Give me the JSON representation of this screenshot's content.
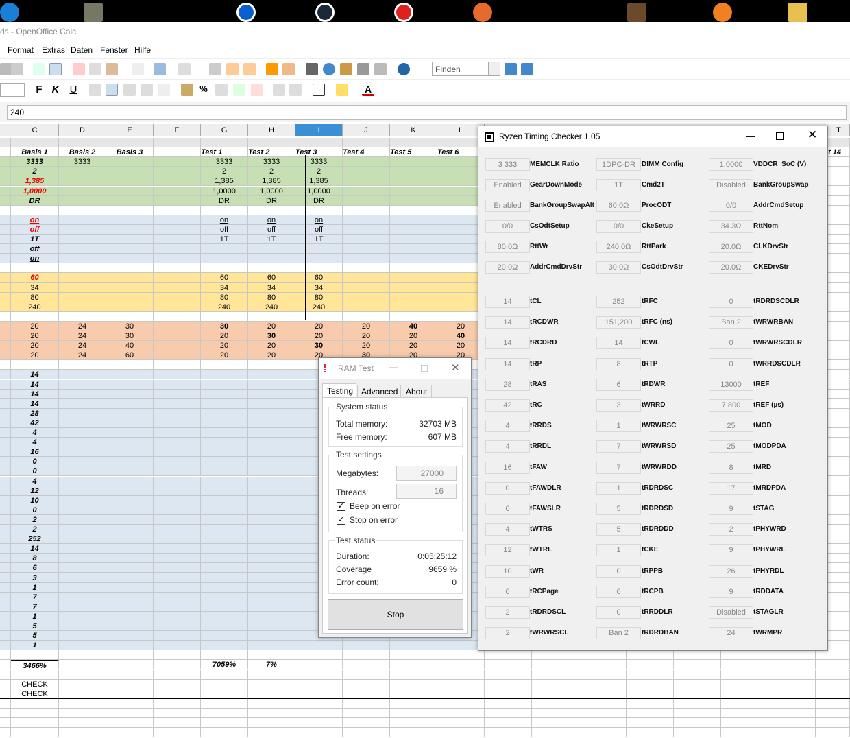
{
  "app": {
    "title": "ds - OpenOffice Calc",
    "menu": [
      "Format",
      "Extras",
      "Daten",
      "Fenster",
      "Hilfe"
    ],
    "find_placeholder": "Finden",
    "formula_value": "240",
    "columns": [
      "C",
      "D",
      "E",
      "F",
      "G",
      "H",
      "I",
      "J",
      "K",
      "L",
      "T"
    ]
  },
  "sheet": {
    "headers": [
      "Basis 1",
      "Basis 2",
      "Basis 3",
      "",
      "Test 1",
      "Test 2",
      "Test 3",
      "Test 4",
      "Test 5",
      "Test 6",
      "st 14"
    ],
    "col_c_top": [
      "3333",
      "2",
      "1,385",
      "1,0000",
      "DR"
    ],
    "col_d_top": "3333",
    "col_g_top": [
      "3333",
      "2",
      "1,385",
      "1,0000",
      "DR"
    ],
    "col_h_top": [
      "3333",
      "2",
      "1,385",
      "1,0000",
      "DR"
    ],
    "col_i_top": [
      "3333",
      "2",
      "1,385"
    ],
    "col_i_mid": [
      "1,0000",
      "DR"
    ],
    "toggles_c": [
      "on",
      "off",
      "1T",
      "off",
      "on"
    ],
    "toggles_g": [
      "on",
      "off",
      "1T"
    ],
    "toggles_h": [
      "on",
      "off",
      "1T"
    ],
    "toggles_i": [
      "on",
      "off",
      "1T"
    ],
    "yellow_c": [
      "60",
      "34",
      "80",
      "240"
    ],
    "yellow_g": [
      "60",
      "34",
      "80",
      "240"
    ],
    "yellow_h": [
      "60",
      "34",
      "80",
      "240"
    ],
    "yellow_i": [
      "60",
      "34",
      "80",
      "240"
    ],
    "orange_c": [
      "20",
      "20",
      "20",
      "20"
    ],
    "orange_d": [
      "24",
      "24",
      "24",
      "24"
    ],
    "orange_e": [
      "30",
      "30",
      "40",
      "60"
    ],
    "orange_g": [
      "30",
      "20",
      "20",
      "20"
    ],
    "orange_h": [
      "20",
      "30",
      "20",
      "20"
    ],
    "orange_i": [
      "20",
      "20",
      "30",
      "20"
    ],
    "orange_j": [
      "20",
      "20",
      "20",
      "30"
    ],
    "orange_k": [
      "40",
      "20",
      "20",
      "20"
    ],
    "orange_l": [
      "20",
      "40",
      "20",
      "20"
    ],
    "blue_c": [
      "14",
      "14",
      "14",
      "14",
      "28",
      "42",
      "4",
      "4",
      "16",
      "0",
      "0",
      "4",
      "12",
      "10",
      "0",
      "2",
      "2",
      "252",
      "14",
      "8",
      "6",
      "3",
      "1",
      "7",
      "7",
      "1",
      "5",
      "5",
      "1"
    ],
    "pct_c": "3466%",
    "pct_g": "7059%",
    "pct_h": "7%",
    "check1": "CHECK",
    "check2": "CHECK"
  },
  "rtc": {
    "title": "Ryzen Timing Checker 1.05",
    "top": [
      [
        "3 333",
        "MEMCLK Ratio",
        "1DPC-DR",
        "DIMM Config",
        "1,0000",
        "VDDCR_SoC (V)"
      ],
      [
        "Enabled",
        "GearDownMode",
        "1T",
        "Cmd2T",
        "Disabled",
        "BankGroupSwap"
      ],
      [
        "Enabled",
        "BankGroupSwapAlt",
        "60.0Ω",
        "ProcODT",
        "0/0",
        "AddrCmdSetup"
      ],
      [
        "0/0",
        "CsOdtSetup",
        "0/0",
        "CkeSetup",
        "34.3Ω",
        "RttNom"
      ],
      [
        "80.0Ω",
        "RttWr",
        "240.0Ω",
        "RttPark",
        "20.0Ω",
        "CLKDrvStr"
      ],
      [
        "20.0Ω",
        "AddrCmdDrvStr",
        "30.0Ω",
        "CsOdtDrvStr",
        "20.0Ω",
        "CKEDrvStr"
      ]
    ],
    "timings": [
      [
        "14",
        "tCL",
        "252",
        "tRFC",
        "0",
        "tRDRDSCDLR"
      ],
      [
        "14",
        "tRCDWR",
        "151,200",
        "tRFC (ns)",
        "Ban 2",
        "tWRWRBAN"
      ],
      [
        "14",
        "tRCDRD",
        "14",
        "tCWL",
        "0",
        "tWRWRSCDLR"
      ],
      [
        "14",
        "tRP",
        "8",
        "tRTP",
        "0",
        "tWRRDSCDLR"
      ],
      [
        "28",
        "tRAS",
        "6",
        "tRDWR",
        "13000",
        "tREF"
      ],
      [
        "42",
        "tRC",
        "3",
        "tWRRD",
        "7 800",
        "tREF (µs)"
      ],
      [
        "4",
        "tRRDS",
        "1",
        "tWRWRSC",
        "25",
        "tMOD"
      ],
      [
        "4",
        "tRRDL",
        "7",
        "tWRWRSD",
        "25",
        "tMODPDA"
      ],
      [
        "16",
        "tFAW",
        "7",
        "tWRWRDD",
        "8",
        "tMRD"
      ],
      [
        "0",
        "tFAWDLR",
        "1",
        "tRDRDSC",
        "17",
        "tMRDPDA"
      ],
      [
        "0",
        "tFAWSLR",
        "5",
        "tRDRDSD",
        "9",
        "tSTAG"
      ],
      [
        "4",
        "tWTRS",
        "5",
        "tRDRDDD",
        "2",
        "tPHYWRD"
      ],
      [
        "12",
        "tWTRL",
        "1",
        "tCKE",
        "9",
        "tPHYWRL"
      ],
      [
        "10",
        "tWR",
        "0",
        "tRPPB",
        "26",
        "tPHYRDL"
      ],
      [
        "0",
        "tRCPage",
        "0",
        "tRCPB",
        "9",
        "tRDDATA"
      ],
      [
        "2",
        "tRDRDSCL",
        "0",
        "tRRDDLR",
        "Disabled",
        "tSTAGLR"
      ],
      [
        "2",
        "tWRWRSCL",
        "Ban 2",
        "tRDRDBAN",
        "24",
        "tWRMPR"
      ]
    ]
  },
  "ramtest": {
    "title": "RAM Test",
    "tabs": [
      "Testing",
      "Advanced",
      "About"
    ],
    "system_status": "System status",
    "total_memory_label": "Total memory:",
    "total_memory": "32703 MB",
    "free_memory_label": "Free memory:",
    "free_memory": "607 MB",
    "test_settings": "Test settings",
    "megabytes_label": "Megabytes:",
    "megabytes": "27000",
    "threads_label": "Threads:",
    "threads": "16",
    "beep_label": "Beep on error",
    "stop_label": "Stop on error",
    "test_status": "Test status",
    "duration_label": "Duration:",
    "duration": "0:05:25:12",
    "coverage_label": "Coverage",
    "coverage": "9659 %",
    "errors_label": "Error count:",
    "errors": "0",
    "stop_button": "Stop"
  }
}
